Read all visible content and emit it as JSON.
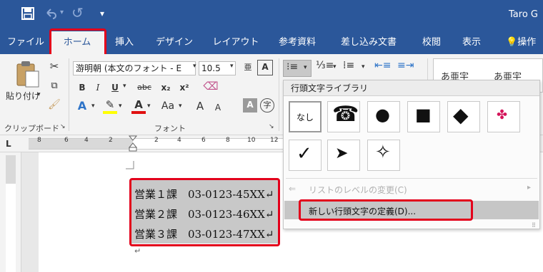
{
  "window": {
    "user": "Taro G",
    "qat_redo_glyph": "↺"
  },
  "tabs": [
    {
      "label": "ファイル"
    },
    {
      "label": "ホーム"
    },
    {
      "label": "挿入"
    },
    {
      "label": "デザイン"
    },
    {
      "label": "レイアウト"
    },
    {
      "label": "参考資料"
    },
    {
      "label": "差し込み文書"
    },
    {
      "label": "校閲"
    },
    {
      "label": "表示"
    },
    {
      "label": "操作"
    }
  ],
  "ribbon": {
    "paste_label": "貼り付け",
    "clipboard_group": "クリップボード",
    "font_group": "フォント",
    "font_name": "游明朝 (本文のフォント - E",
    "font_size": "10.5",
    "bold": "B",
    "italic": "I",
    "underline": "U",
    "strike": "abc",
    "subscript": "x₂",
    "superscript": "x²",
    "case_button": "Aa",
    "grow_font": "A",
    "shrink_font": "A",
    "char_border": "A",
    "phonetic": "A",
    "enclose": "字",
    "style_preview": "あ亜宇"
  },
  "ruler": {
    "ticks": [
      "8",
      "6",
      "4",
      "2",
      "",
      "2",
      "4",
      "6",
      "8",
      "10",
      "12"
    ],
    "tab_marker": "L"
  },
  "document": {
    "lines": [
      "営業１課　03-0123-45XX↵",
      "営業２課　03-0123-46XX↵",
      "営業３課　03-0123-47XX↵"
    ],
    "paragraph_mark": "↵"
  },
  "bullet_panel": {
    "title": "行頭文字ライブラリ",
    "none_label": "なし",
    "symbols": [
      "☎",
      "●",
      "■",
      "◆",
      "✤",
      "✓",
      "➤",
      "✧"
    ],
    "change_level": "リストのレベルの変更(C)",
    "define_new": "新しい行頭文字の定義(D)..."
  }
}
